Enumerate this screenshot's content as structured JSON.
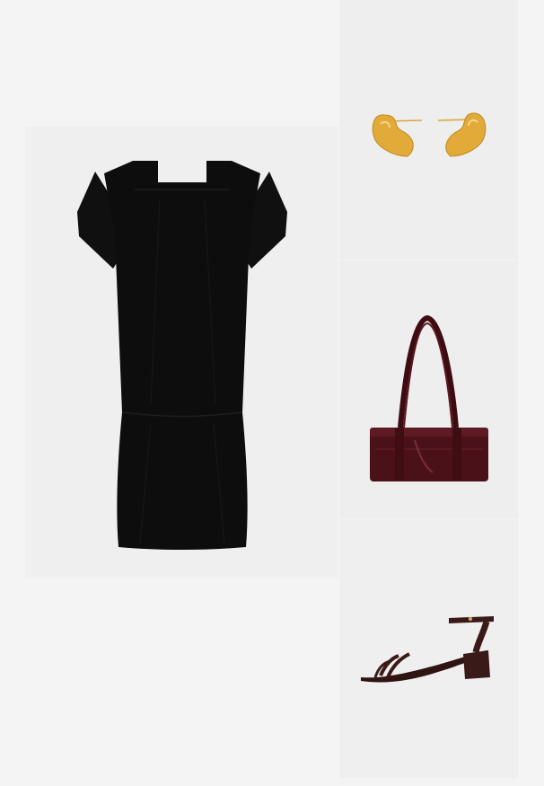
{
  "collage": {
    "products": [
      {
        "item": "dress",
        "color": "#0e0e0e",
        "icon": "black-tiered-midi-dress"
      },
      {
        "item": "earrings",
        "color": "#e0a93a",
        "icon": "gold-heart-earrings"
      },
      {
        "item": "bag",
        "color": "#4a1218",
        "icon": "burgundy-patent-shoulder-bag"
      },
      {
        "item": "sandal",
        "color": "#3a1a18",
        "icon": "brown-patent-block-heel-sandal"
      }
    ]
  }
}
